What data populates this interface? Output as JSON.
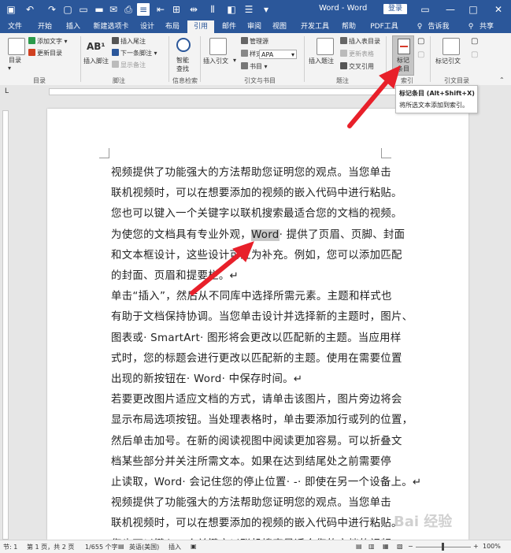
{
  "window": {
    "title": "Word - Word",
    "login": "登录",
    "controls": [
      "minimize",
      "restore",
      "close"
    ]
  },
  "tabs": [
    {
      "label": "文件",
      "active": false
    },
    {
      "label": "开始",
      "active": false
    },
    {
      "label": "插入",
      "active": false
    },
    {
      "label": "新建选项卡",
      "active": false
    },
    {
      "label": "设计",
      "active": false
    },
    {
      "label": "布局",
      "active": false
    },
    {
      "label": "引用",
      "active": true
    },
    {
      "label": "邮件",
      "active": false
    },
    {
      "label": "审阅",
      "active": false
    },
    {
      "label": "视图",
      "active": false
    },
    {
      "label": "开发工具",
      "active": false
    },
    {
      "label": "帮助",
      "active": false
    },
    {
      "label": "PDF工具集",
      "active": false
    }
  ],
  "tab_right": {
    "tell_me": "告诉我",
    "share": "共享"
  },
  "ribbon": {
    "toc": {
      "button": "目录",
      "add_text": "添加文字",
      "update_toc": "更新目录",
      "group": "目录"
    },
    "footnotes": {
      "insert_footnote": "插入脚注",
      "insert_endnote": "插入尾注",
      "next_footnote": "下一条脚注",
      "show_notes": "显示备注",
      "group": "脚注"
    },
    "research": {
      "smart_lookup_1": "智能",
      "smart_lookup_2": "查找",
      "group": "信息检索"
    },
    "citations": {
      "insert_citation": "插入引文",
      "manage_sources": "管理源",
      "style_label": "样式:",
      "style_value": "APA",
      "bibliography": "书目",
      "group": "引文与书目"
    },
    "captions": {
      "insert_caption": "插入题注",
      "insert_table_of_figures": "插入表目录",
      "update_table": "更新表格",
      "cross_reference": "交叉引用",
      "group": "题注"
    },
    "index": {
      "mark_entry_1": "标记",
      "mark_entry_2": "条目",
      "group": "索引"
    },
    "toa": {
      "mark_citation": "标记引文",
      "group": "引文目录"
    }
  },
  "tooltip": {
    "title": "标记条目 (Alt+Shift+X)",
    "body": "将所选文本添加到索引。"
  },
  "document": {
    "lines": [
      {
        "text": "视频提供了功能强大的方法帮助您证明您的观点。当您单击"
      },
      {
        "text": "联机视频时，可以在想要添加的视频的嵌入代码中进行粘贴。"
      },
      {
        "text": "您也可以键入一个关键字以联机搜索最适合您的文档的视频。"
      },
      {
        "before": "为使您的文档具有专业外观，",
        "highlight": "Word",
        "after": "· 提供了页眉、页脚、封面"
      },
      {
        "text": "和文本框设计，这些设计可互为补充。例如，您可以添加匹配"
      },
      {
        "text": "的封面、页眉和提要栏。↵"
      },
      {
        "text": "单击“插入”，然后从不同库中选择所需元素。主题和样式也"
      },
      {
        "text": "有助于文档保持协调。当您单击设计并选择新的主题时，图片、"
      },
      {
        "text": "图表或· SmartArt· 图形将会更改以匹配新的主题。当应用样"
      },
      {
        "text": "式时，您的标题会进行更改以匹配新的主题。使用在需要位置"
      },
      {
        "text": "出现的新按钮在· Word· 中保存时间。↵"
      },
      {
        "text": "若要更改图片适应文档的方式，请单击该图片，图片旁边将会"
      },
      {
        "text": "显示布局选项按钮。当处理表格时，单击要添加行或列的位置，"
      },
      {
        "text": "然后单击加号。在新的阅读视图中阅读更加容易。可以折叠文"
      },
      {
        "text": "档某些部分并关注所需文本。如果在达到结尾处之前需要停"
      },
      {
        "text": "止读取，Word· 会记住您的停止位置· -· 即使在另一个设备上。↵"
      },
      {
        "text": "视频提供了功能强大的方法帮助您证明您的观点。当您单击"
      },
      {
        "text": "联机视频时，可以在想要添加的视频的嵌入代码中进行粘贴。"
      },
      {
        "text": "您也可以键入一个关键字以联机搜索最适合您的文档的视频。"
      }
    ]
  },
  "statusbar": {
    "section": "节: 1",
    "page": "第 1 页，共 2 页",
    "words": "1/655 个字",
    "language": "英语(美国)",
    "insert_mode": "插入",
    "zoom": "100%"
  },
  "watermark": "Bai 经验",
  "colors": {
    "accent": "#2b579a",
    "arrow": "#e8202a",
    "highlight": "#c8c8c8"
  }
}
